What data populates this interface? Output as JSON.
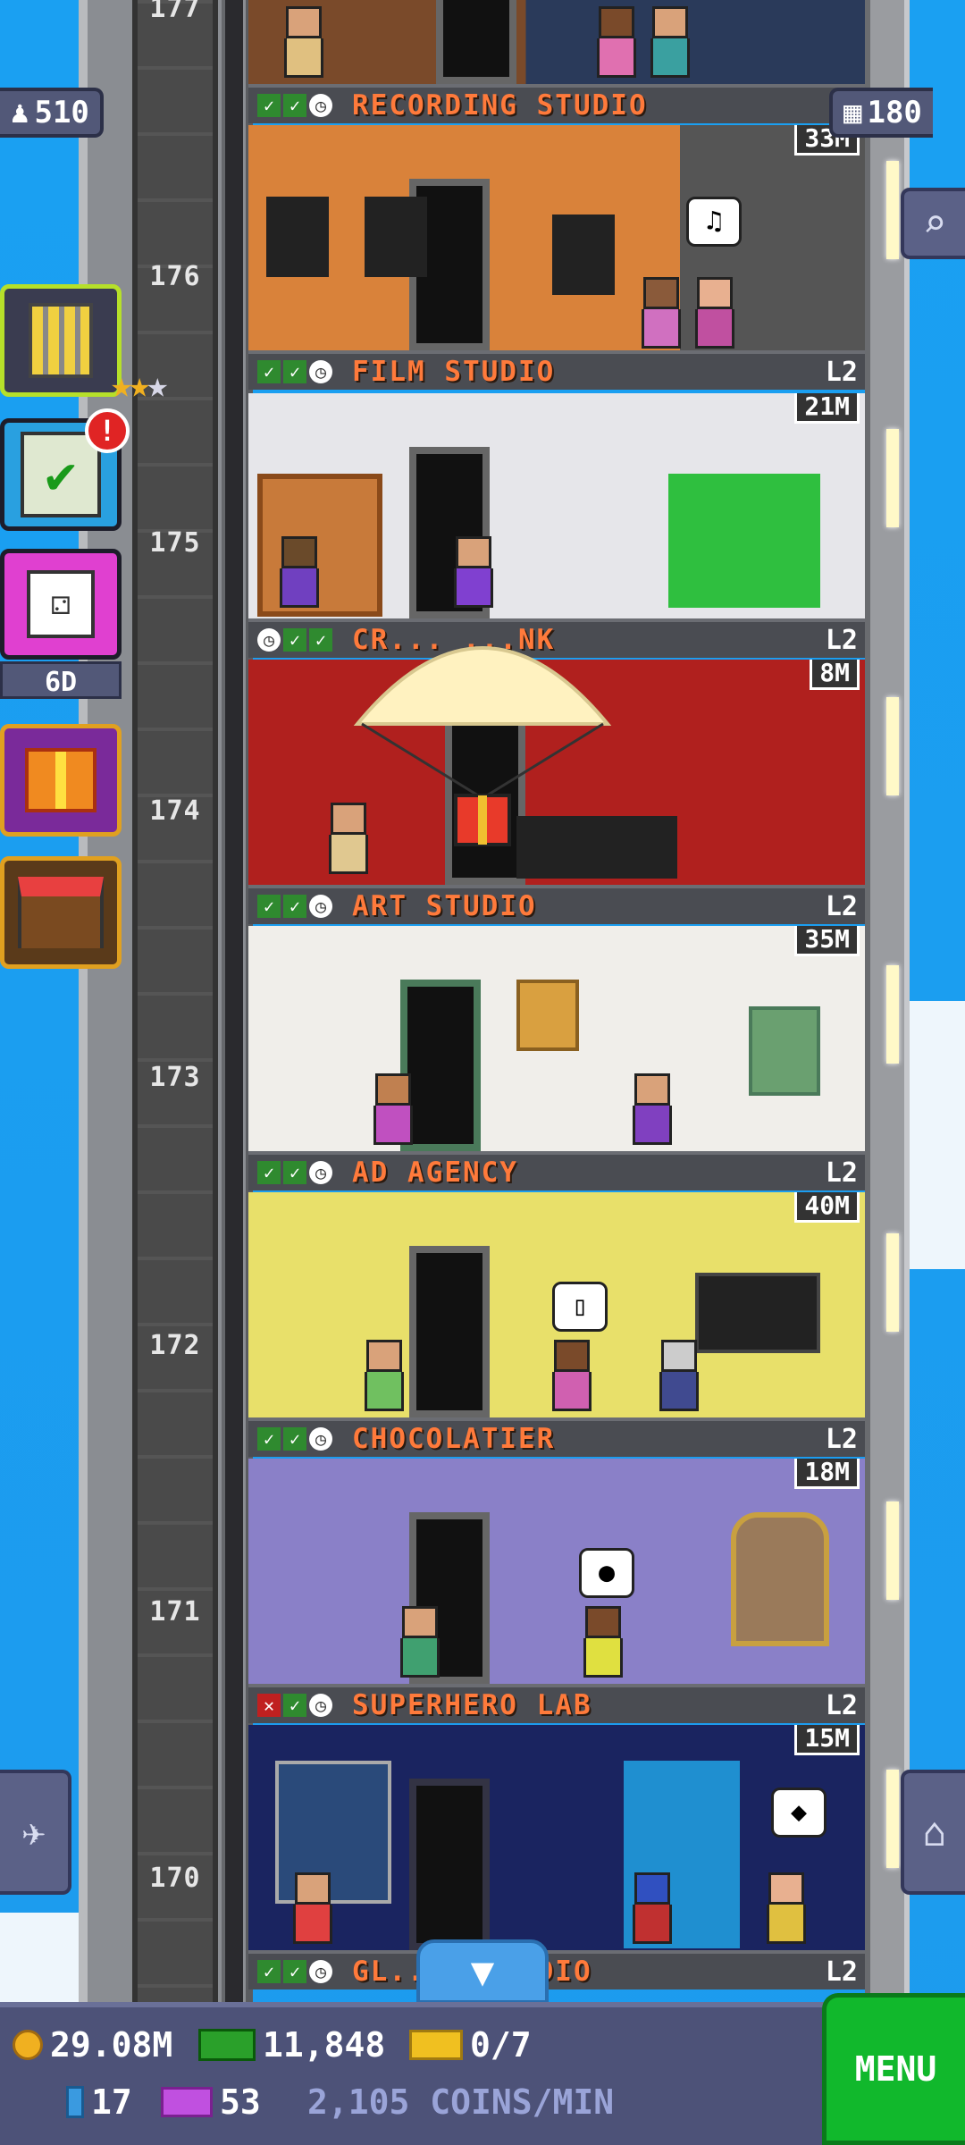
{
  "hud": {
    "bitizens": "510",
    "floors": "180",
    "dice_timer": "6D"
  },
  "floors": [
    {
      "num": "177",
      "name": "RECORDING STUDIO",
      "level": "",
      "pop": "",
      "checks": [
        "check",
        "check",
        "clock"
      ]
    },
    {
      "num": "176",
      "name": "FILM STUDIO",
      "level": "L2",
      "pop": "33M",
      "checks": [
        "check",
        "check",
        "clock"
      ]
    },
    {
      "num": "175",
      "name": "CR... ...NK",
      "level": "L2",
      "pop": "21M",
      "checks": [
        "clock",
        "check",
        "check"
      ]
    },
    {
      "num": "174",
      "name": "ART STUDIO",
      "level": "L2",
      "pop": "8M",
      "checks": [
        "check",
        "check",
        "clock"
      ]
    },
    {
      "num": "173",
      "name": "AD AGENCY",
      "level": "L2",
      "pop": "35M",
      "checks": [
        "check",
        "check",
        "clock"
      ]
    },
    {
      "num": "172",
      "name": "CHOCOLATIER",
      "level": "L2",
      "pop": "40M",
      "checks": [
        "check",
        "check",
        "clock"
      ]
    },
    {
      "num": "171",
      "name": "SUPERHERO LAB",
      "level": "L2",
      "pop": "18M",
      "checks": [
        "x",
        "check",
        "clock"
      ]
    },
    {
      "num": "170",
      "name": "GL... ...UDIO",
      "level": "L2",
      "pop": "15M",
      "checks": [
        "check",
        "check",
        "clock"
      ]
    }
  ],
  "bottom": {
    "coins": "29.08M",
    "bux": "11,848",
    "tickets": "0/7",
    "keys": "17",
    "vip": "53",
    "rate": "2,105 COINS/MIN",
    "menu": "MENU"
  },
  "icons": {
    "bitizen": "person-icon",
    "floors": "building-icon",
    "search": "magnifier-icon",
    "elevator": "elevator-icon",
    "home": "home-icon"
  },
  "colors": {
    "sky": "#1c9bee",
    "floor_name": "#ff7a3b",
    "menu_green": "#11b82c",
    "hud_panel": "#4d5278"
  }
}
